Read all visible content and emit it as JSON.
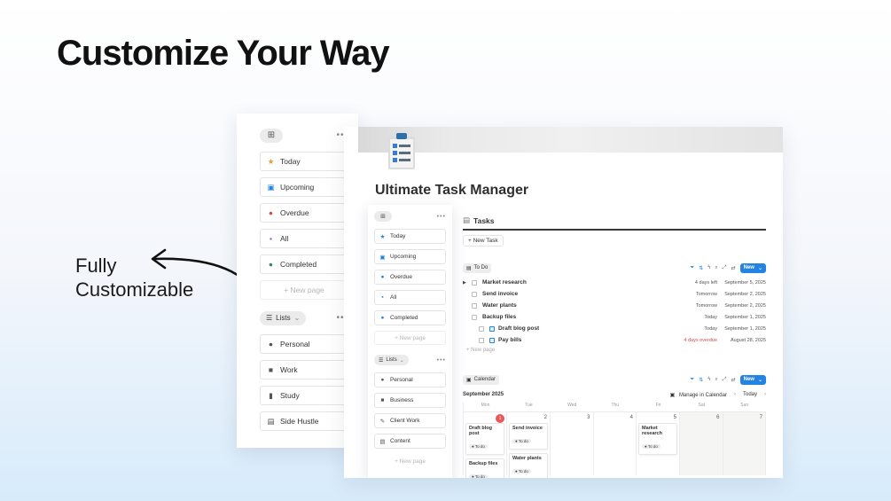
{
  "hero": {
    "title": "Customize Your Way"
  },
  "label": {
    "line1": "Fully",
    "line2": "Customizable"
  },
  "sidebar": {
    "nav": [
      {
        "label": "Today",
        "icon": "star-icon",
        "glyph": "★",
        "color": "#d9a12c"
      },
      {
        "label": "Upcoming",
        "icon": "calendar-icon",
        "glyph": "▣",
        "color": "#2383e2"
      },
      {
        "label": "Overdue",
        "icon": "alert-icon",
        "glyph": "●",
        "color": "#d44c47"
      },
      {
        "label": "All",
        "icon": "document-icon",
        "glyph": "▪",
        "color": "#9065b0"
      },
      {
        "label": "Completed",
        "icon": "check-circle-icon",
        "glyph": "●",
        "color": "#448361"
      }
    ],
    "new_page": "+ New page",
    "lists_label": "Lists",
    "lists": [
      {
        "label": "Personal",
        "icon": "person-icon",
        "glyph": "●"
      },
      {
        "label": "Work",
        "icon": "briefcase-icon",
        "glyph": "■"
      },
      {
        "label": "Study",
        "icon": "book-icon",
        "glyph": "▮"
      },
      {
        "label": "Side Hustle",
        "icon": "note-icon",
        "glyph": "▤"
      }
    ]
  },
  "page": {
    "title": "Ultimate Task Manager"
  },
  "small_sidebar": {
    "nav": [
      {
        "label": "Today",
        "icon": "star-icon",
        "glyph": "★",
        "color": "#2383e2"
      },
      {
        "label": "Upcoming",
        "icon": "calendar-icon",
        "glyph": "▣",
        "color": "#2383e2"
      },
      {
        "label": "Overdue",
        "icon": "alert-icon",
        "glyph": "●",
        "color": "#2383e2"
      },
      {
        "label": "All",
        "icon": "document-icon",
        "glyph": "▪",
        "color": "#2383e2"
      },
      {
        "label": "Completed",
        "icon": "check-circle-icon",
        "glyph": "●",
        "color": "#2383e2"
      }
    ],
    "new_page": "+ New page",
    "lists_label": "Lists",
    "lists": [
      {
        "label": "Personal",
        "icon": "person-icon",
        "glyph": "●"
      },
      {
        "label": "Business",
        "icon": "briefcase-icon",
        "glyph": "■"
      },
      {
        "label": "Client Work",
        "icon": "edit-icon",
        "glyph": "✎"
      },
      {
        "label": "Content",
        "icon": "note-icon",
        "glyph": "▤"
      }
    ],
    "new_page_bottom": "+ New page"
  },
  "tasks": {
    "heading": "Tasks",
    "new_task": "+ New Task",
    "view_label": "To Do",
    "new_button": "New",
    "rows": [
      {
        "name": "Market research",
        "due": "4 days left",
        "date": "September 5, 2025",
        "toggle": "▶",
        "overdue": false,
        "sub": false
      },
      {
        "name": "Send invoice",
        "due": "Tomorrow",
        "date": "September 2, 2025",
        "toggle": "",
        "overdue": false,
        "sub": false
      },
      {
        "name": "Water plants",
        "due": "Tomorrow",
        "date": "September 2, 2025",
        "toggle": "",
        "overdue": false,
        "sub": false
      },
      {
        "name": "Backup files",
        "due": "Today",
        "date": "September 1, 2025",
        "toggle": "",
        "overdue": false,
        "sub": false
      },
      {
        "name": "Draft blog post",
        "due": "Today",
        "date": "September 1, 2025",
        "toggle": "",
        "overdue": false,
        "sub": true
      },
      {
        "name": "Pay bills",
        "due": "4 days overdue",
        "date": "August 28, 2025",
        "toggle": "",
        "overdue": true,
        "sub": true
      }
    ],
    "new_page": "+ New page"
  },
  "calendar": {
    "view_label": "Calendar",
    "new_button": "New",
    "month": "September 2025",
    "manage": "Manage in Calendar",
    "today": "Today",
    "dow": [
      "Mon",
      "Tue",
      "Wed",
      "Thu",
      "Fri",
      "Sat",
      "Sun"
    ],
    "days": [
      {
        "num": "1",
        "today": true,
        "events": [
          {
            "name": "Draft blog post",
            "badge": "To do"
          },
          {
            "name": "Backup files",
            "badge": "To do"
          }
        ]
      },
      {
        "num": "2",
        "today": false,
        "events": [
          {
            "name": "Send invoice",
            "badge": "To do"
          },
          {
            "name": "Water plants",
            "badge": "To do"
          }
        ]
      },
      {
        "num": "3",
        "today": false,
        "events": []
      },
      {
        "num": "4",
        "today": false,
        "events": []
      },
      {
        "num": "5",
        "today": false,
        "events": [
          {
            "name": "Market research",
            "badge": "To do"
          }
        ]
      },
      {
        "num": "6",
        "today": false,
        "events": []
      },
      {
        "num": "7",
        "today": false,
        "events": []
      }
    ]
  }
}
